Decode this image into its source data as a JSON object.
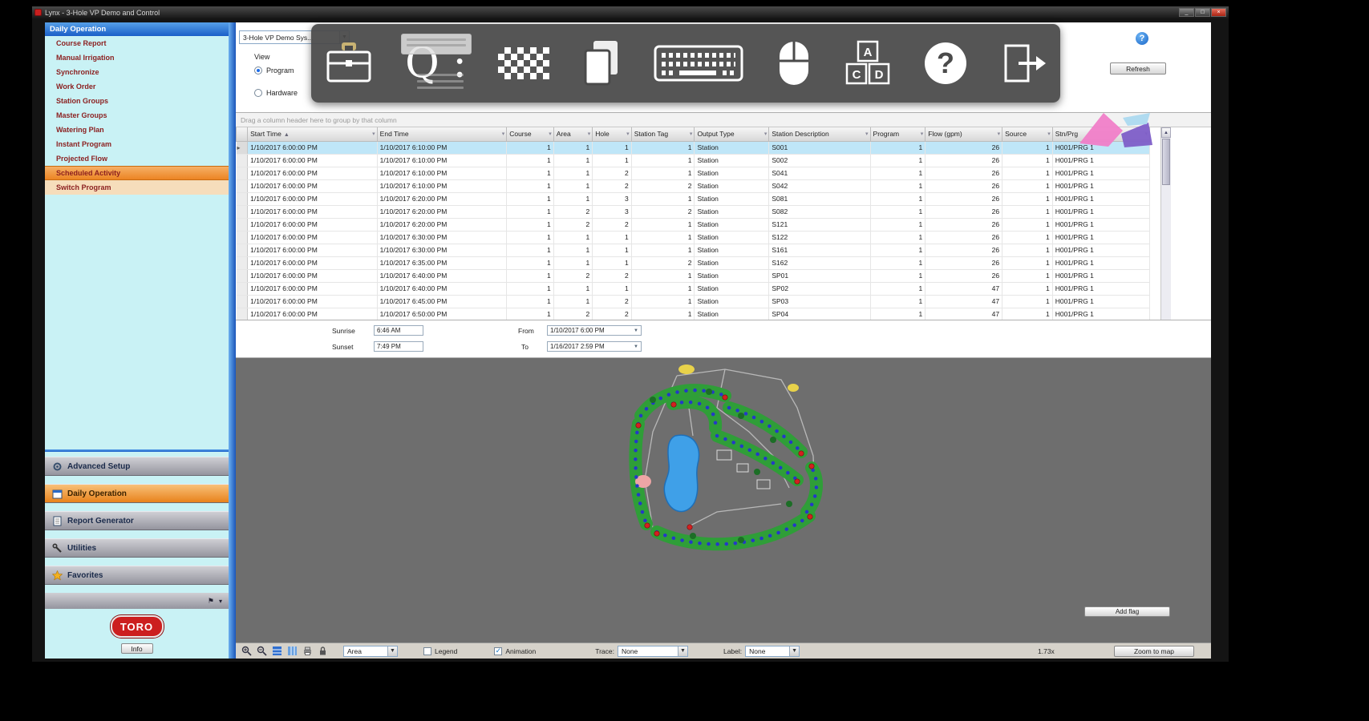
{
  "titlebar": {
    "title": "Lynx - 3-Hole VP Demo and Control",
    "minimize": "_",
    "maximize": "□",
    "close": "×"
  },
  "sidebar": {
    "header": "Daily Operation",
    "items": [
      {
        "label": "Course Report",
        "state": ""
      },
      {
        "label": "Manual Irrigation",
        "state": ""
      },
      {
        "label": "Synchronize",
        "state": ""
      },
      {
        "label": "Work Order",
        "state": ""
      },
      {
        "label": "Station Groups",
        "state": ""
      },
      {
        "label": "Master Groups",
        "state": ""
      },
      {
        "label": "Watering Plan",
        "state": ""
      },
      {
        "label": "Instant Program",
        "state": ""
      },
      {
        "label": "Projected Flow",
        "state": ""
      },
      {
        "label": "Scheduled Activity",
        "state": "selected"
      },
      {
        "label": "Switch Program",
        "state": "hover"
      }
    ],
    "nav": [
      {
        "label": "Advanced Setup"
      },
      {
        "label": "Daily Operation"
      },
      {
        "label": "Report Generator"
      },
      {
        "label": "Utilities"
      },
      {
        "label": "Favorites"
      }
    ],
    "logo_text": "TORO",
    "footer_button": "Info"
  },
  "toolbar": {
    "system_select": "3-Hole VP Demo Sys...",
    "view_label": "View",
    "radio_program": "Program",
    "radio_hardware": "Hardware",
    "refresh_button": "Refresh",
    "help_glyph": "?"
  },
  "grid": {
    "group_hint": "Drag a column header here to group by that column",
    "columns": [
      "Start Time",
      "End Time",
      "Course",
      "Area",
      "Hole",
      "Station Tag",
      "Output Type",
      "Station Description",
      "Program",
      "Flow (gpm)",
      "Source",
      "Stn/Prg"
    ],
    "rows": [
      [
        "1/10/2017 6:00:00 PM",
        "1/10/2017 6:10:00 PM",
        "1",
        "1",
        "1",
        "1",
        "Station",
        "S001",
        "1",
        "26",
        "1",
        "H001/PRG 1"
      ],
      [
        "1/10/2017 6:00:00 PM",
        "1/10/2017 6:10:00 PM",
        "1",
        "1",
        "1",
        "1",
        "Station",
        "S002",
        "1",
        "26",
        "1",
        "H001/PRG 1"
      ],
      [
        "1/10/2017 6:00:00 PM",
        "1/10/2017 6:10:00 PM",
        "1",
        "1",
        "2",
        "1",
        "Station",
        "S041",
        "1",
        "26",
        "1",
        "H001/PRG 1"
      ],
      [
        "1/10/2017 6:00:00 PM",
        "1/10/2017 6:10:00 PM",
        "1",
        "1",
        "2",
        "2",
        "Station",
        "S042",
        "1",
        "26",
        "1",
        "H001/PRG 1"
      ],
      [
        "1/10/2017 6:00:00 PM",
        "1/10/2017 6:20:00 PM",
        "1",
        "1",
        "3",
        "1",
        "Station",
        "S081",
        "1",
        "26",
        "1",
        "H001/PRG 1"
      ],
      [
        "1/10/2017 6:00:00 PM",
        "1/10/2017 6:20:00 PM",
        "1",
        "2",
        "3",
        "2",
        "Station",
        "S082",
        "1",
        "26",
        "1",
        "H001/PRG 1"
      ],
      [
        "1/10/2017 6:00:00 PM",
        "1/10/2017 6:20:00 PM",
        "1",
        "2",
        "2",
        "1",
        "Station",
        "S121",
        "1",
        "26",
        "1",
        "H001/PRG 1"
      ],
      [
        "1/10/2017 6:00:00 PM",
        "1/10/2017 6:30:00 PM",
        "1",
        "1",
        "1",
        "1",
        "Station",
        "S122",
        "1",
        "26",
        "1",
        "H001/PRG 1"
      ],
      [
        "1/10/2017 6:00:00 PM",
        "1/10/2017 6:30:00 PM",
        "1",
        "1",
        "1",
        "1",
        "Station",
        "S161",
        "1",
        "26",
        "1",
        "H001/PRG 1"
      ],
      [
        "1/10/2017 6:00:00 PM",
        "1/10/2017 6:35:00 PM",
        "1",
        "1",
        "1",
        "2",
        "Station",
        "S162",
        "1",
        "26",
        "1",
        "H001/PRG 1"
      ],
      [
        "1/10/2017 6:00:00 PM",
        "1/10/2017 6:40:00 PM",
        "1",
        "2",
        "2",
        "1",
        "Station",
        "SP01",
        "1",
        "26",
        "1",
        "H001/PRG 1"
      ],
      [
        "1/10/2017 6:00:00 PM",
        "1/10/2017 6:40:00 PM",
        "1",
        "1",
        "1",
        "1",
        "Station",
        "SP02",
        "1",
        "47",
        "1",
        "H001/PRG 1"
      ],
      [
        "1/10/2017 6:00:00 PM",
        "1/10/2017 6:45:00 PM",
        "1",
        "1",
        "2",
        "1",
        "Station",
        "SP03",
        "1",
        "47",
        "1",
        "H001/PRG 1"
      ],
      [
        "1/10/2017 6:00:00 PM",
        "1/10/2017 6:50:00 PM",
        "1",
        "2",
        "2",
        "1",
        "Station",
        "SP04",
        "1",
        "47",
        "1",
        "H001/PRG 1"
      ]
    ]
  },
  "range_panel": {
    "sunrise_label": "Sunrise",
    "sunrise_value": "6:46 AM",
    "sunset_label": "Sunset",
    "sunset_value": "7:49 PM",
    "from_label": "From",
    "from_value": "1/10/2017 6:00 PM",
    "to_label": "To",
    "to_value": "1/16/2017 2:59 PM"
  },
  "map": {
    "add_button": "Add flag"
  },
  "map_toolbar": {
    "area_select": "Area",
    "legend_label": "Legend",
    "animation_label": "Animation",
    "trace_label": "Trace:",
    "trace_value": "None",
    "label_label": "Label:",
    "label_value": "None",
    "zoom_value": "1.73x",
    "zoom_button": "Zoom to map"
  },
  "overlay": {
    "search_glyph": "Q :"
  }
}
